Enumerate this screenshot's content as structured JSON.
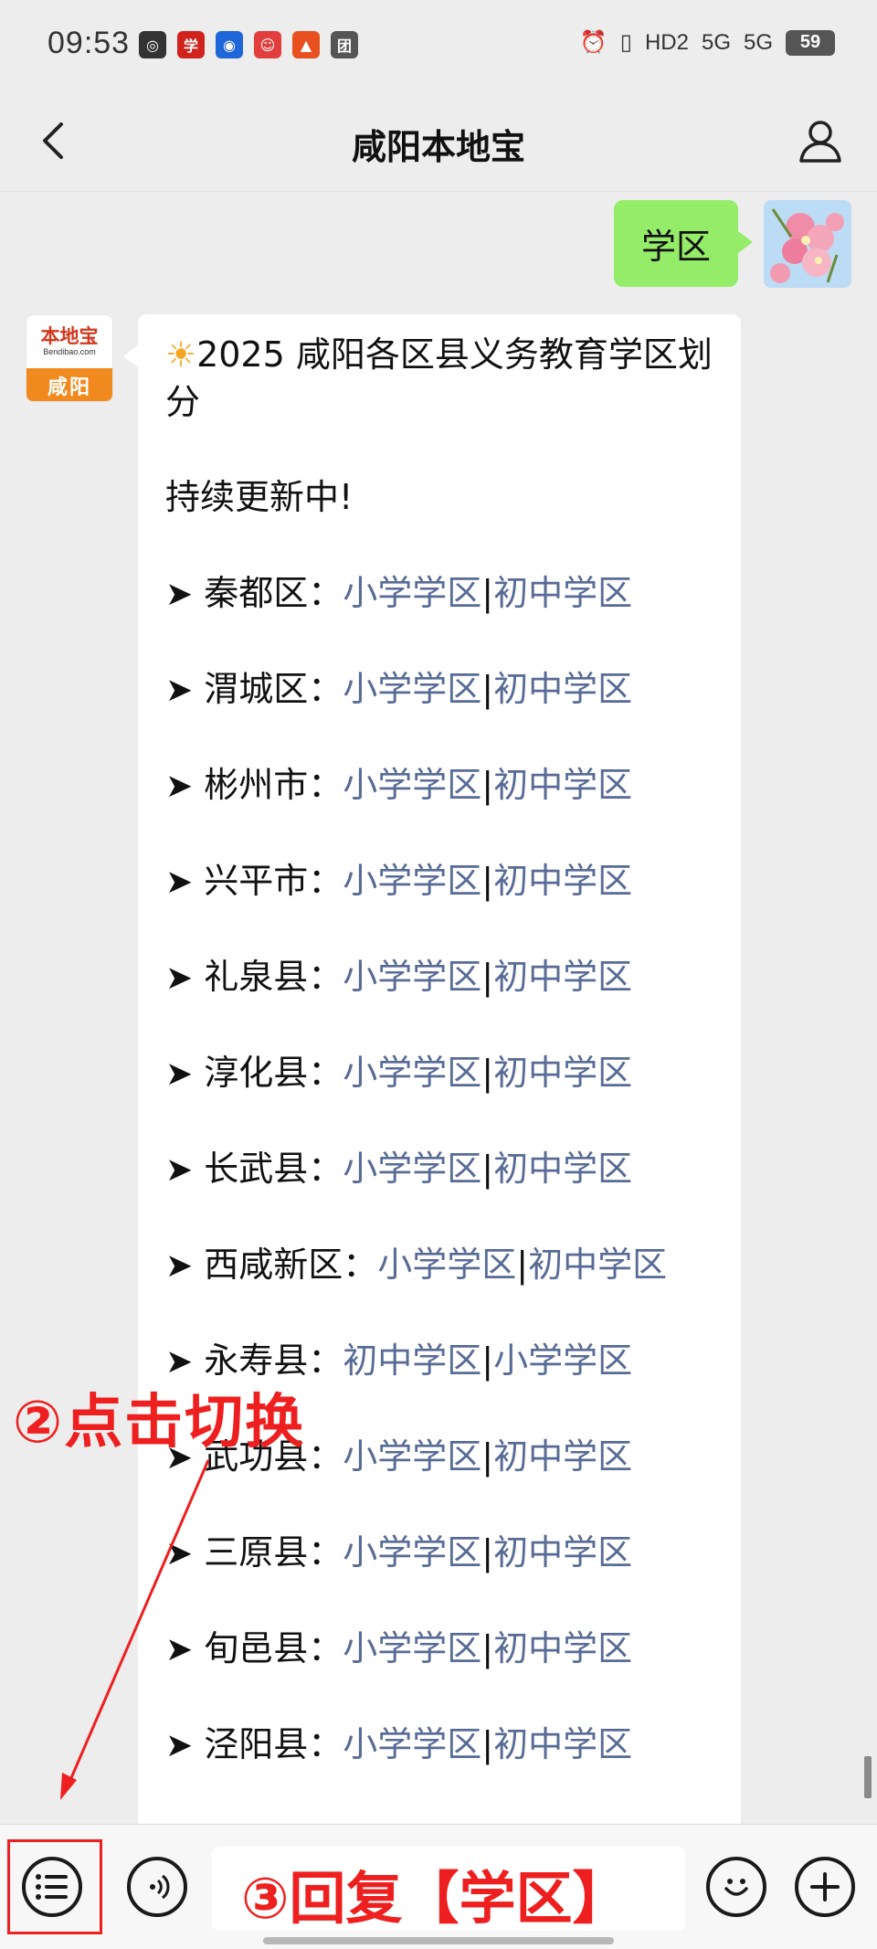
{
  "status_bar": {
    "time": "09:53",
    "app_icons": [
      {
        "name": "netease-music-icon",
        "glyph": "◎",
        "color": "#333333"
      },
      {
        "name": "xuexi-icon",
        "glyph": "学",
        "color": "#d0231c"
      },
      {
        "name": "app-blue-icon",
        "glyph": "◉",
        "color": "#1f66d9"
      },
      {
        "name": "app-red-face-icon",
        "glyph": "☺",
        "color": "#e23e3e"
      },
      {
        "name": "app-orange-icon",
        "glyph": "▲",
        "color": "#e8511f"
      },
      {
        "name": "app-tuan-icon",
        "glyph": "团",
        "color": "#555555"
      }
    ],
    "alarm": "⏰",
    "vibrate": "▯",
    "hd": "HD2",
    "signal_1": "5G",
    "signal_2": "5G",
    "battery": "59"
  },
  "header": {
    "title": "咸阳本地宝"
  },
  "user_message": {
    "text": "学区"
  },
  "bot": {
    "avatar_brand": "本地宝",
    "avatar_domain": "Bendibao.com",
    "avatar_city": "咸阳"
  },
  "bot_message": {
    "title_icon": "☀",
    "title": "2025 咸阳各区县义务教育学区划分",
    "subtitle": "持续更新中!",
    "districts": [
      {
        "name": "秦都区：",
        "link1": "小学学区",
        "link2": "初中学区"
      },
      {
        "name": "渭城区：",
        "link1": "小学学区",
        "link2": "初中学区"
      },
      {
        "name": "彬州市：",
        "link1": "小学学区",
        "link2": "初中学区"
      },
      {
        "name": "兴平市：",
        "link1": "小学学区",
        "link2": "初中学区"
      },
      {
        "name": "礼泉县：",
        "link1": "小学学区",
        "link2": "初中学区"
      },
      {
        "name": "淳化县：",
        "link1": "小学学区",
        "link2": "初中学区"
      },
      {
        "name": "长武县：",
        "link1": "小学学区",
        "link2": "初中学区"
      },
      {
        "name": "西咸新区：",
        "link1": "小学学区",
        "link2": "初中学区"
      },
      {
        "name": "永寿县：",
        "link1": "初中学区",
        "link2": "小学学区"
      },
      {
        "name": "武功县：",
        "link1": "小学学区",
        "link2": "初中学区"
      },
      {
        "name": "三原县：",
        "link1": "小学学区",
        "link2": "初中学区"
      },
      {
        "name": "旬邑县：",
        "link1": "小学学区",
        "link2": "初中学区"
      },
      {
        "name": "泾阳县：",
        "link1": "小学学区",
        "link2": "初中学区"
      }
    ],
    "arrow": "➤",
    "separator": "|"
  },
  "annotations": {
    "switch": "②点击切换",
    "reply": "③回复【学区】"
  },
  "colors": {
    "link": "#576b95",
    "user_bubble": "#95ec69",
    "annotation": "#ee1f1f"
  }
}
